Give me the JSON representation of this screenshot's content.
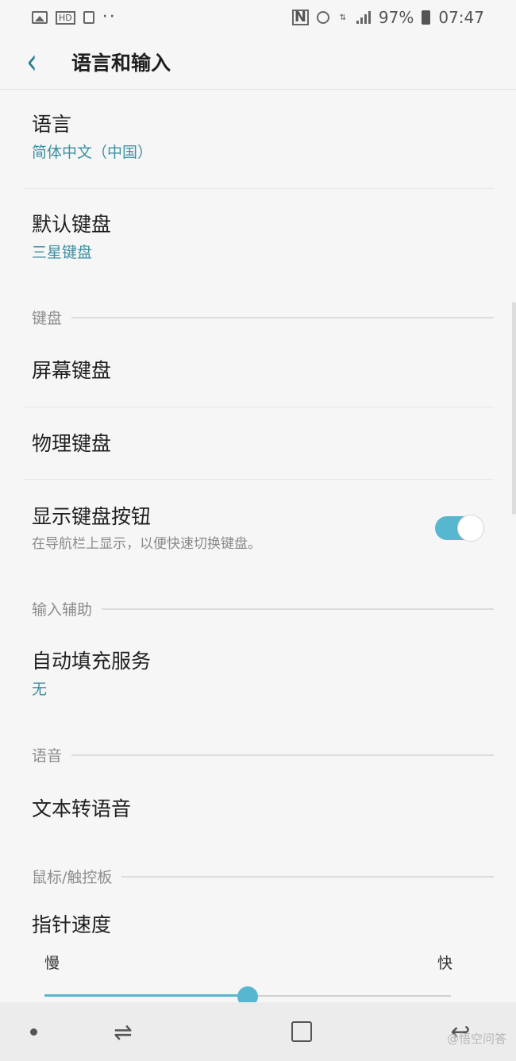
{
  "status_bar": {
    "left_icons": [
      "image-icon",
      "hd-icon",
      "bag-icon",
      "more-dots-icon"
    ],
    "right_icons": [
      "nfc-icon",
      "alarm-icon",
      "network-icon",
      "signal-icon"
    ],
    "battery": "97%",
    "time": "07:47"
  },
  "header": {
    "back_icon": "chevron-left-icon",
    "title": "语言和输入"
  },
  "items": {
    "language": {
      "title": "语言",
      "value": "简体中文（中国）"
    },
    "default_keyboard": {
      "title": "默认键盘",
      "value": "三星键盘"
    },
    "onscreen_keyboard": {
      "title": "屏幕键盘"
    },
    "physical_keyboard": {
      "title": "物理键盘"
    },
    "show_keyboard_button": {
      "title": "显示键盘按钮",
      "description": "在导航栏上显示，以便快速切换键盘。",
      "toggle_on": true
    },
    "autofill_service": {
      "title": "自动填充服务",
      "value": "无"
    },
    "tts": {
      "title": "文本转语音"
    },
    "pointer_speed": {
      "title": "指针速度",
      "min_label": "慢",
      "max_label": "快",
      "value_fraction": 0.5
    }
  },
  "sections": {
    "keyboard": "键盘",
    "input_assist": "输入辅助",
    "voice": "语音",
    "mouse_touchpad": "鼠标/触控板"
  },
  "colors": {
    "accent": "#57b7d1",
    "subtitle": "#3c8fa2",
    "background": "#f6f6f6"
  },
  "nav_bar": {
    "icons": [
      "nav-dot-icon",
      "recent-apps-icon",
      "home-icon",
      "back-icon"
    ]
  },
  "watermark": "@悟空问答"
}
